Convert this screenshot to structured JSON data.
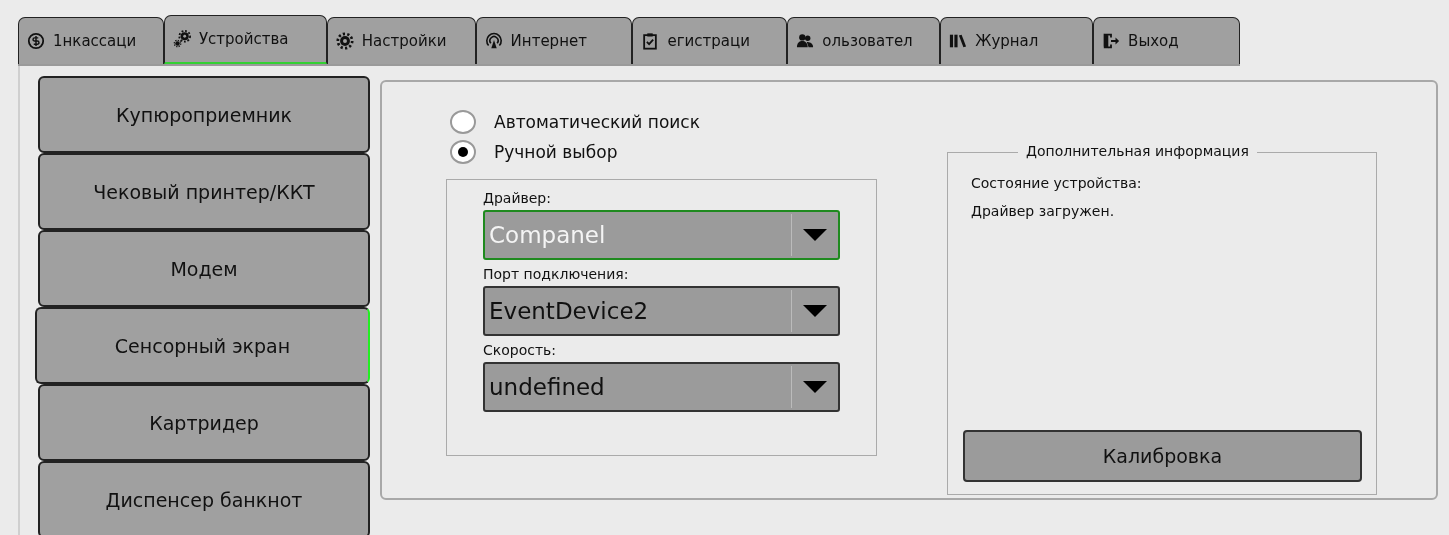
{
  "tabs": [
    {
      "label": "1нкассаци",
      "selected": false
    },
    {
      "label": "Устройства",
      "selected": true
    },
    {
      "label": "Настройки",
      "selected": false
    },
    {
      "label": "Интернет",
      "selected": false
    },
    {
      "label": "егистраци",
      "selected": false
    },
    {
      "label": "ользовател",
      "selected": false
    },
    {
      "label": "Журнал",
      "selected": false
    },
    {
      "label": "Выход",
      "selected": false
    }
  ],
  "devices": [
    {
      "label": "Купюроприемник",
      "selected": false
    },
    {
      "label": "Чековый принтер/ККТ",
      "selected": false
    },
    {
      "label": "Модем",
      "selected": false
    },
    {
      "label": "Сенсорный экран",
      "selected": true
    },
    {
      "label": "Картридер",
      "selected": false
    },
    {
      "label": "Диспенсер банкнот",
      "selected": false
    }
  ],
  "search_mode": [
    {
      "label": "Автоматический поиск",
      "selected": false
    },
    {
      "label": "Ручной выбор",
      "selected": true
    }
  ],
  "fields": [
    {
      "label": "Драйвер:",
      "value": "Companel",
      "focused": true
    },
    {
      "label": "Порт подключения:",
      "value": "EventDevice2",
      "focused": false
    },
    {
      "label": "Скорость:",
      "value": "undefined",
      "focused": false
    }
  ],
  "info": {
    "title": "Дополнительная информация",
    "lines": [
      "Состояние устройства:",
      "Драйвер загружен."
    ],
    "button": "Калибровка"
  }
}
